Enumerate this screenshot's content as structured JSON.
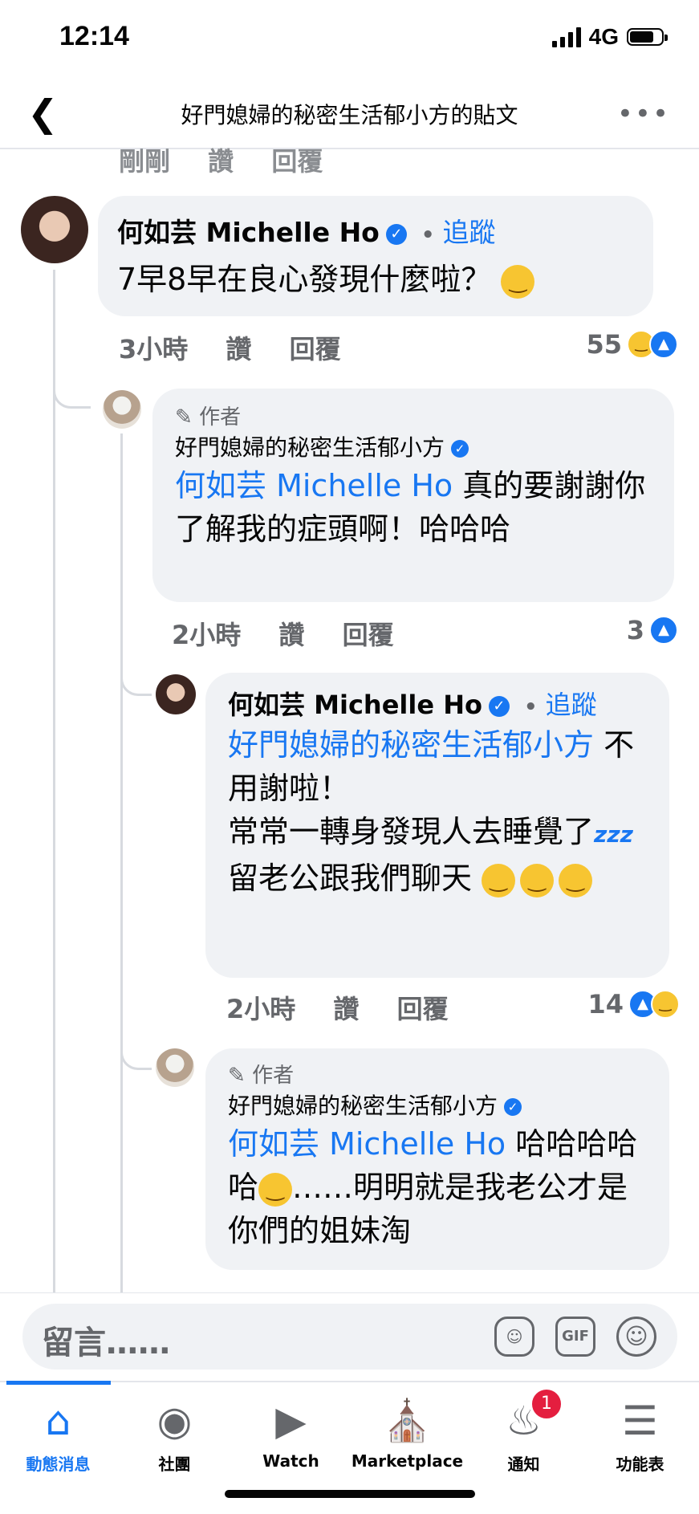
{
  "status_bar": {
    "time": "12:14",
    "network": "4G"
  },
  "header": {
    "title": "好門媳婦的秘密生活郁小方的貼文",
    "back_icon": "chevron-left-icon",
    "more_icon": "ellipsis-icon"
  },
  "prev_actions": {
    "time": "剛剛",
    "like": "讚",
    "reply": "回覆"
  },
  "comments": [
    {
      "author": "何如芸 Michelle Ho",
      "follow": "追蹤",
      "text": "7早8早在良心發現什麼啦？",
      "emoji": "😆",
      "time": "3小時",
      "like": "讚",
      "reply": "回覆",
      "reaction_count": "55"
    },
    {
      "author_tag": "作者",
      "author": "好門媳婦的秘密生活郁小方",
      "mention": "何如芸 Michelle Ho",
      "text": "真的要謝謝你了解我的症頭啊！哈哈哈",
      "time": "2小時",
      "like": "讚",
      "reply": "回覆",
      "reaction_count": "3"
    },
    {
      "author": "何如芸 Michelle Ho",
      "follow": "追蹤",
      "mention": "好門媳婦的秘密生活郁小方",
      "text_line1": "不用謝啦！",
      "text_line2": "常常一轉身發現人去睡覺了",
      "zzz": "zzz",
      "text_line3": "留老公跟我們聊天",
      "time": "2小時",
      "like": "讚",
      "reply": "回覆",
      "reaction_count": "14"
    },
    {
      "author_tag": "作者",
      "author": "好門媳婦的秘密生活郁小方",
      "mention": "何如芸 Michelle Ho",
      "text_a": "哈哈哈哈哈",
      "text_b": "……明明就是我老公才是你們的姐妹淘"
    }
  ],
  "composer": {
    "placeholder": "留言……",
    "gif_label": "GIF"
  },
  "tabs": [
    {
      "label": "動態消息",
      "icon": "home-icon",
      "active": true
    },
    {
      "label": "社團",
      "icon": "groups-icon"
    },
    {
      "label": "Watch",
      "icon": "watch-icon"
    },
    {
      "label": "Marketplace",
      "icon": "marketplace-icon"
    },
    {
      "label": "通知",
      "icon": "bell-icon",
      "badge": "1"
    },
    {
      "label": "功能表",
      "icon": "menu-icon"
    }
  ],
  "colors": {
    "accent": "#1877f2",
    "bubble": "#f0f2f5",
    "meta": "#65676b"
  }
}
